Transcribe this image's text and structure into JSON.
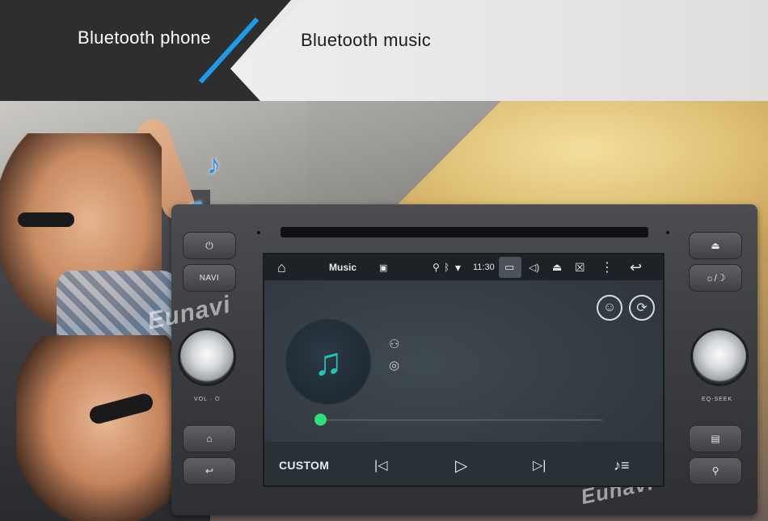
{
  "banner": {
    "tab_phone": "Bluetooth phone",
    "tab_music": "Bluetooth music",
    "accent_color": "#1e9be8"
  },
  "photo": {
    "note_icon_a": "♪",
    "note_icon_b": "♫"
  },
  "head_unit": {
    "left_buttons": {
      "power_icon": "⏻",
      "navi_label": "NAVI",
      "home_icon": "⌂",
      "back_icon": "↩"
    },
    "right_buttons": {
      "eject_icon": "⏏",
      "brightness_icon": "☼/☽",
      "radio_icon": "▤",
      "gps_icon": "⚲"
    },
    "knob_left_label": "VOL · ⏻",
    "knob_right_label": "EQ-SEEK",
    "watermark": "Eunavi"
  },
  "screen": {
    "status": {
      "home_icon": "⌂",
      "app_title": "Music",
      "image_icon": "▣",
      "location_icon": "⚲",
      "bluetooth_icon": "ᛒ",
      "wifi_icon": "▾",
      "time": "11:30",
      "screenshot_icon": "▭",
      "volume_icon": "◁)",
      "eject_icon": "⏏",
      "close_icon": "☒",
      "more_icon": "⋮",
      "back_icon": "↩"
    },
    "top_right": {
      "artist_icon": "☺",
      "repeat_icon": "⟳"
    },
    "album_note_icon": "♫",
    "meta": {
      "artist_icon": "⚇",
      "album_icon": "◎"
    },
    "progress": 0,
    "controls": {
      "custom_label": "CUSTOM",
      "prev_icon": "|◁",
      "play_icon": "▷",
      "next_icon": "▷|",
      "playlist_icon": "♪≡"
    }
  }
}
